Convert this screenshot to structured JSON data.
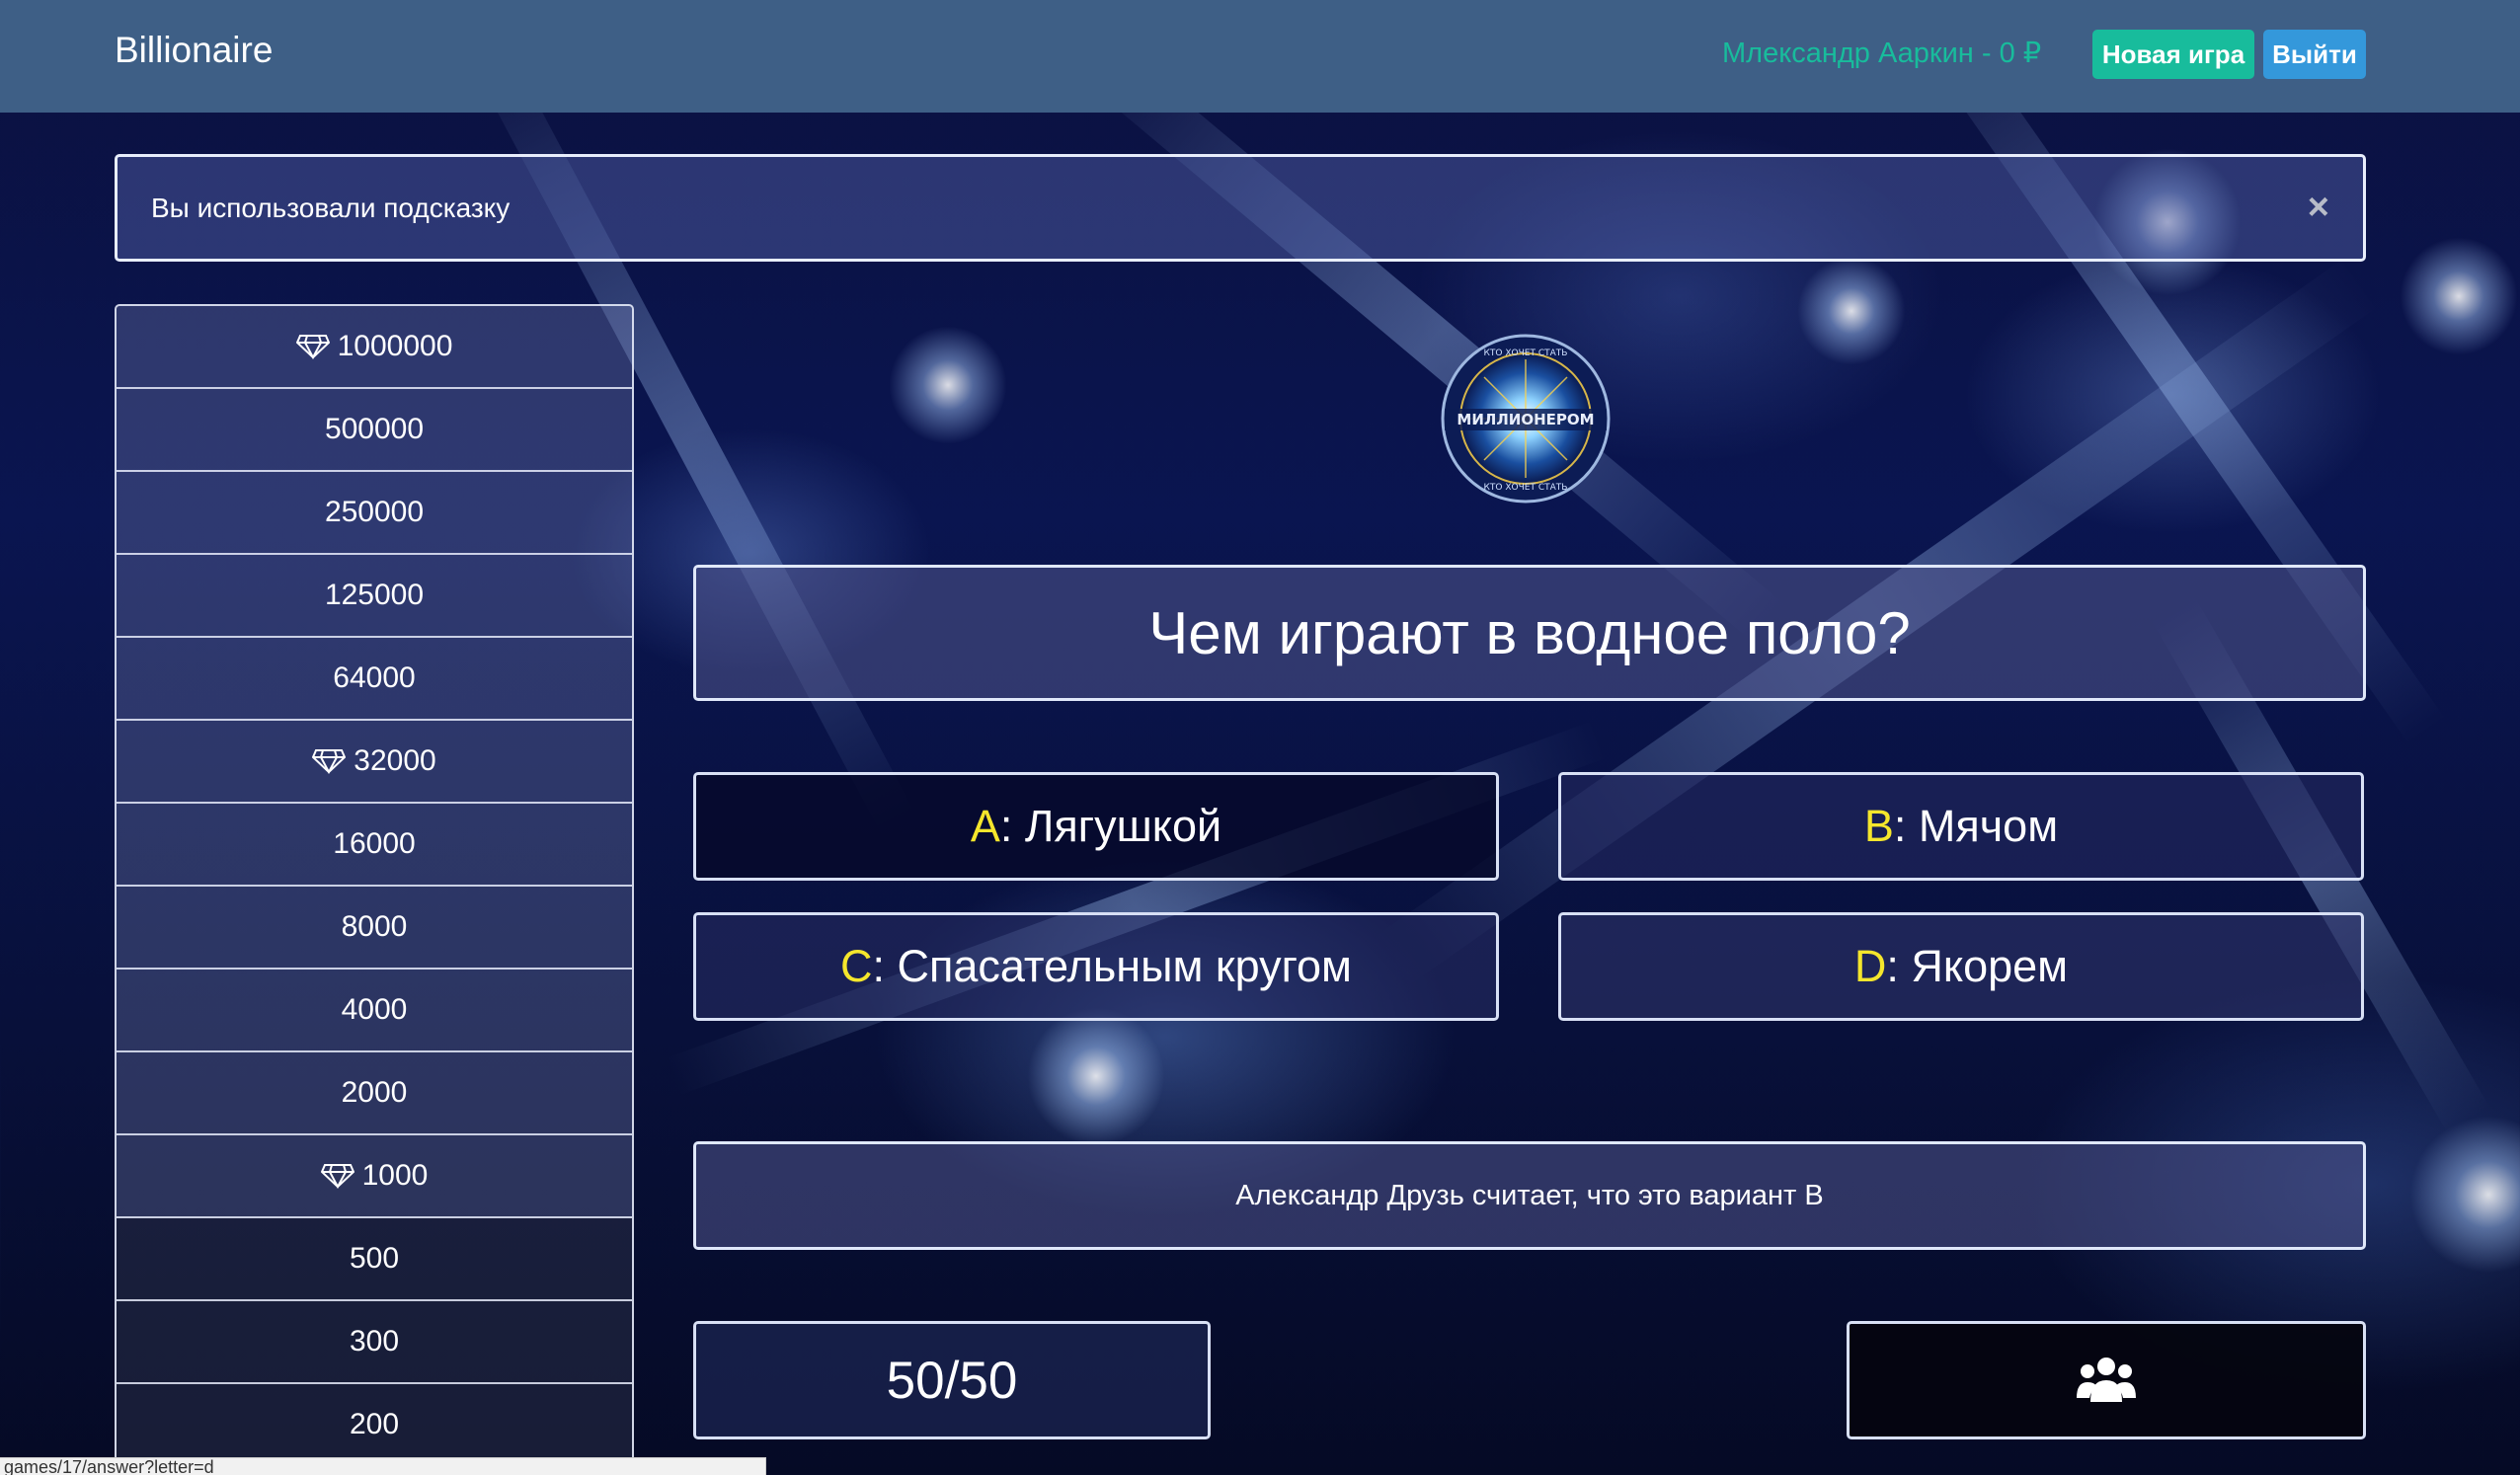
{
  "navbar": {
    "brand": "Billionaire",
    "user": "Млександр Ааркин - 0 ₽",
    "new_game_label": "Новая игра",
    "exit_label": "Выйти"
  },
  "alert": {
    "message": "Вы использовали подсказку",
    "close_symbol": "×"
  },
  "ladder": [
    {
      "amount": "1000000",
      "milestone": true
    },
    {
      "amount": "500000",
      "milestone": false
    },
    {
      "amount": "250000",
      "milestone": false
    },
    {
      "amount": "125000",
      "milestone": false
    },
    {
      "amount": "64000",
      "milestone": false
    },
    {
      "amount": "32000",
      "milestone": true
    },
    {
      "amount": "16000",
      "milestone": false
    },
    {
      "amount": "8000",
      "milestone": false
    },
    {
      "amount": "4000",
      "milestone": false
    },
    {
      "amount": "2000",
      "milestone": false
    },
    {
      "amount": "1000",
      "milestone": true
    },
    {
      "amount": "500",
      "milestone": false
    },
    {
      "amount": "300",
      "milestone": false
    },
    {
      "amount": "200",
      "milestone": false
    }
  ],
  "logo": {
    "top_text": "КТО ХОЧЕТ СТАТЬ",
    "center_text": "МИЛЛИОНЕРОМ",
    "bottom_text": "КТО ХОЧЕТ СТАТЬ"
  },
  "question": "Чем играют в водное поло?",
  "answers": [
    {
      "letter": "A",
      "text": ": Лягушкой"
    },
    {
      "letter": "B",
      "text": ": Мячом"
    },
    {
      "letter": "C",
      "text": ": Спасательным кругом"
    },
    {
      "letter": "D",
      "text": ": Якорем"
    }
  ],
  "hint_text": "Александр Друзь считает, что это вариант B",
  "lifelines": {
    "fifty_fifty": "50/50",
    "audience_icon": "users-icon"
  },
  "statusbar_url": "games/17/answer?letter=d"
}
